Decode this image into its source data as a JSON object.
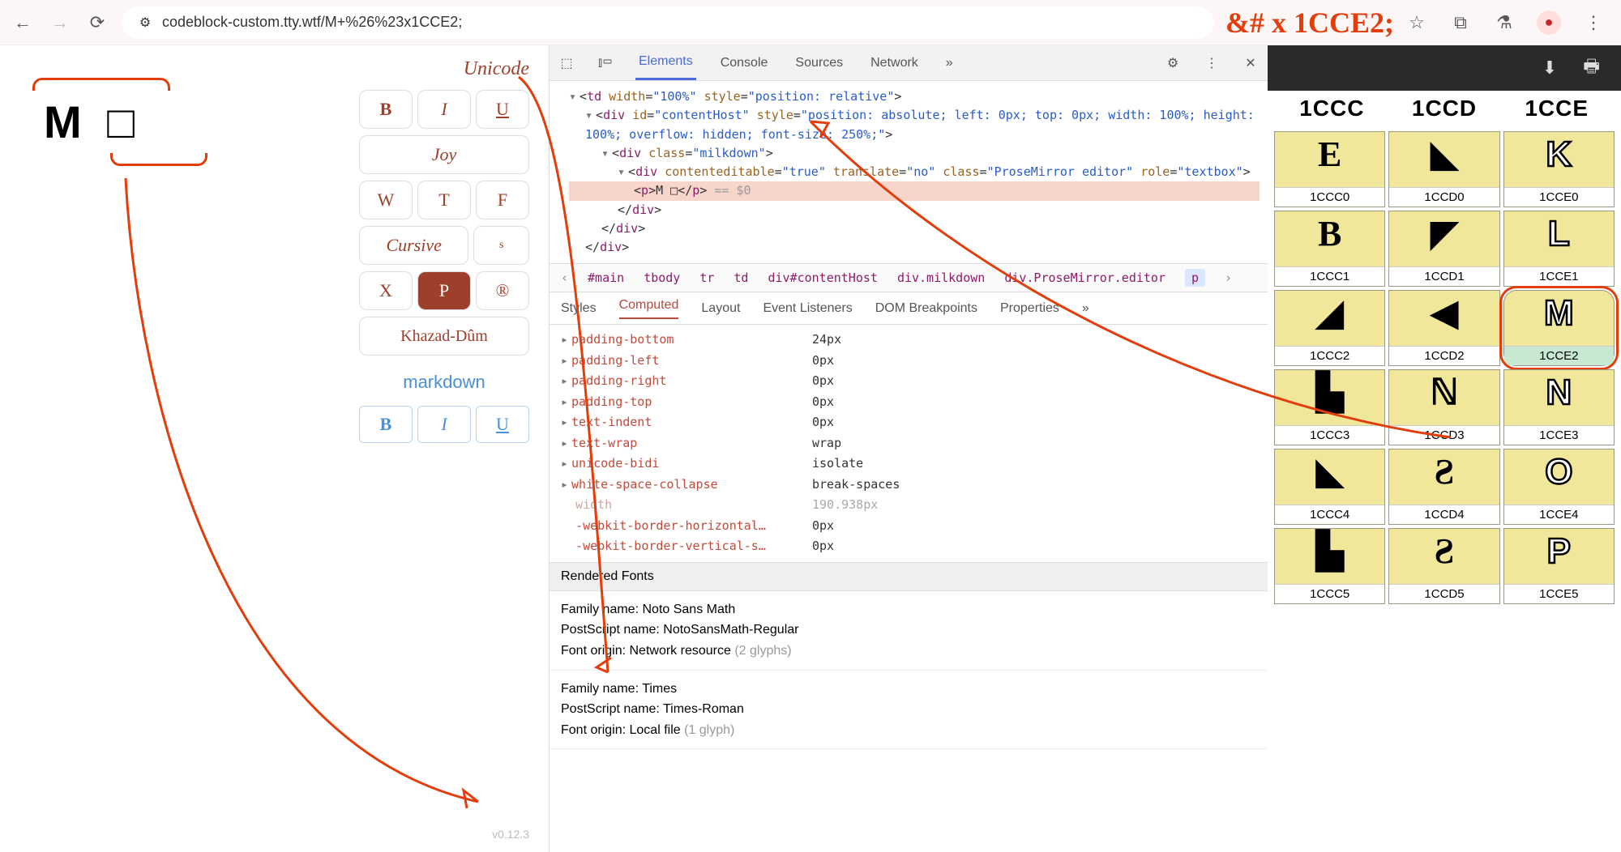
{
  "chrome": {
    "url": "codeblock-custom.tty.wtf/M+%26%23x1CCE2;",
    "annotation": "&# x 1CCE2;"
  },
  "left": {
    "glyph_text": "M □",
    "toolbar_title": "Unicode",
    "row1": [
      "B",
      "I",
      "U"
    ],
    "joy": "Joy",
    "row3": [
      "W",
      "T",
      "F"
    ],
    "cursive": "Cursive",
    "cursive_sup": "s",
    "row5": [
      "X",
      "P",
      "®"
    ],
    "khazad": "Khazad-Dûm",
    "markdown_label": "markdown",
    "md_row": [
      "B",
      "I",
      "U"
    ],
    "version": "v0.12.3"
  },
  "devtools": {
    "tabs": [
      "Elements",
      "Console",
      "Sources",
      "Network"
    ],
    "tabs_more": "»",
    "dom_p_text": "M □",
    "dom_eq": " == $0",
    "crumbs": [
      "#main",
      "tbody",
      "tr",
      "td",
      "div#contentHost",
      "div.milkdown",
      "div.ProseMirror.editor",
      "p"
    ],
    "subtabs": [
      "Styles",
      "Computed",
      "Layout",
      "Event Listeners",
      "DOM Breakpoints",
      "Properties"
    ],
    "computed": [
      {
        "prop": "padding-bottom",
        "value": "24px",
        "tri": true
      },
      {
        "prop": "padding-left",
        "value": "0px",
        "tri": true
      },
      {
        "prop": "padding-right",
        "value": "0px",
        "tri": true
      },
      {
        "prop": "padding-top",
        "value": "0px",
        "tri": true
      },
      {
        "prop": "text-indent",
        "value": "0px",
        "tri": true
      },
      {
        "prop": "text-wrap",
        "value": "wrap",
        "tri": true
      },
      {
        "prop": "unicode-bidi",
        "value": "isolate",
        "tri": true
      },
      {
        "prop": "white-space-collapse",
        "value": "break-spaces",
        "tri": true
      },
      {
        "prop": "width",
        "value": "190.938px",
        "dim": true
      },
      {
        "prop": "-webkit-border-horizontal…",
        "value": "0px"
      },
      {
        "prop": "-webkit-border-vertical-s…",
        "value": "0px"
      }
    ],
    "rendered_fonts_hdr": "Rendered Fonts",
    "font1": {
      "family_label": "Family name:",
      "family": "Noto Sans Math",
      "ps_label": "PostScript name:",
      "ps": "NotoSansMath-Regular",
      "origin_label": "Font origin:",
      "origin": "Network resource",
      "glyphs": "(2 glyphs)"
    },
    "font2": {
      "family_label": "Family name:",
      "family": "Times",
      "ps_label": "PostScript name:",
      "ps": "Times-Roman",
      "origin_label": "Font origin:",
      "origin": "Local file",
      "glyphs": "(1 glyph)"
    }
  },
  "right": {
    "col_headers": [
      "1CCC",
      "1CCD",
      "1CCE"
    ],
    "cells": [
      {
        "glyph": "Ε",
        "code": "1CCC0",
        "outline": false
      },
      {
        "glyph": "◣",
        "code": "1CCD0",
        "outline": false
      },
      {
        "glyph": "K",
        "code": "1CCE0",
        "outline": true
      },
      {
        "glyph": "Β",
        "code": "1CCC1",
        "outline": false
      },
      {
        "glyph": "◤",
        "code": "1CCD1",
        "outline": false
      },
      {
        "glyph": "L",
        "code": "1CCE1",
        "outline": true
      },
      {
        "glyph": "◢",
        "code": "1CCC2",
        "outline": false
      },
      {
        "glyph": "◀",
        "code": "1CCD2",
        "outline": false
      },
      {
        "glyph": "M",
        "code": "1CCE2",
        "outline": true,
        "highlighted": true
      },
      {
        "glyph": "▙",
        "code": "1CCC3",
        "outline": false
      },
      {
        "glyph": "ℕ",
        "code": "1CCD3",
        "outline": false
      },
      {
        "glyph": "N",
        "code": "1CCE3",
        "outline": true
      },
      {
        "glyph": "◣",
        "code": "1CCC4",
        "outline": false
      },
      {
        "glyph": "Ƨ",
        "code": "1CCD4",
        "outline": false
      },
      {
        "glyph": "O",
        "code": "1CCE4",
        "outline": true
      },
      {
        "glyph": "▙",
        "code": "1CCC5",
        "outline": false
      },
      {
        "glyph": "Ƨ",
        "code": "1CCD5",
        "outline": false
      },
      {
        "glyph": "P",
        "code": "1CCE5",
        "outline": true
      }
    ]
  }
}
